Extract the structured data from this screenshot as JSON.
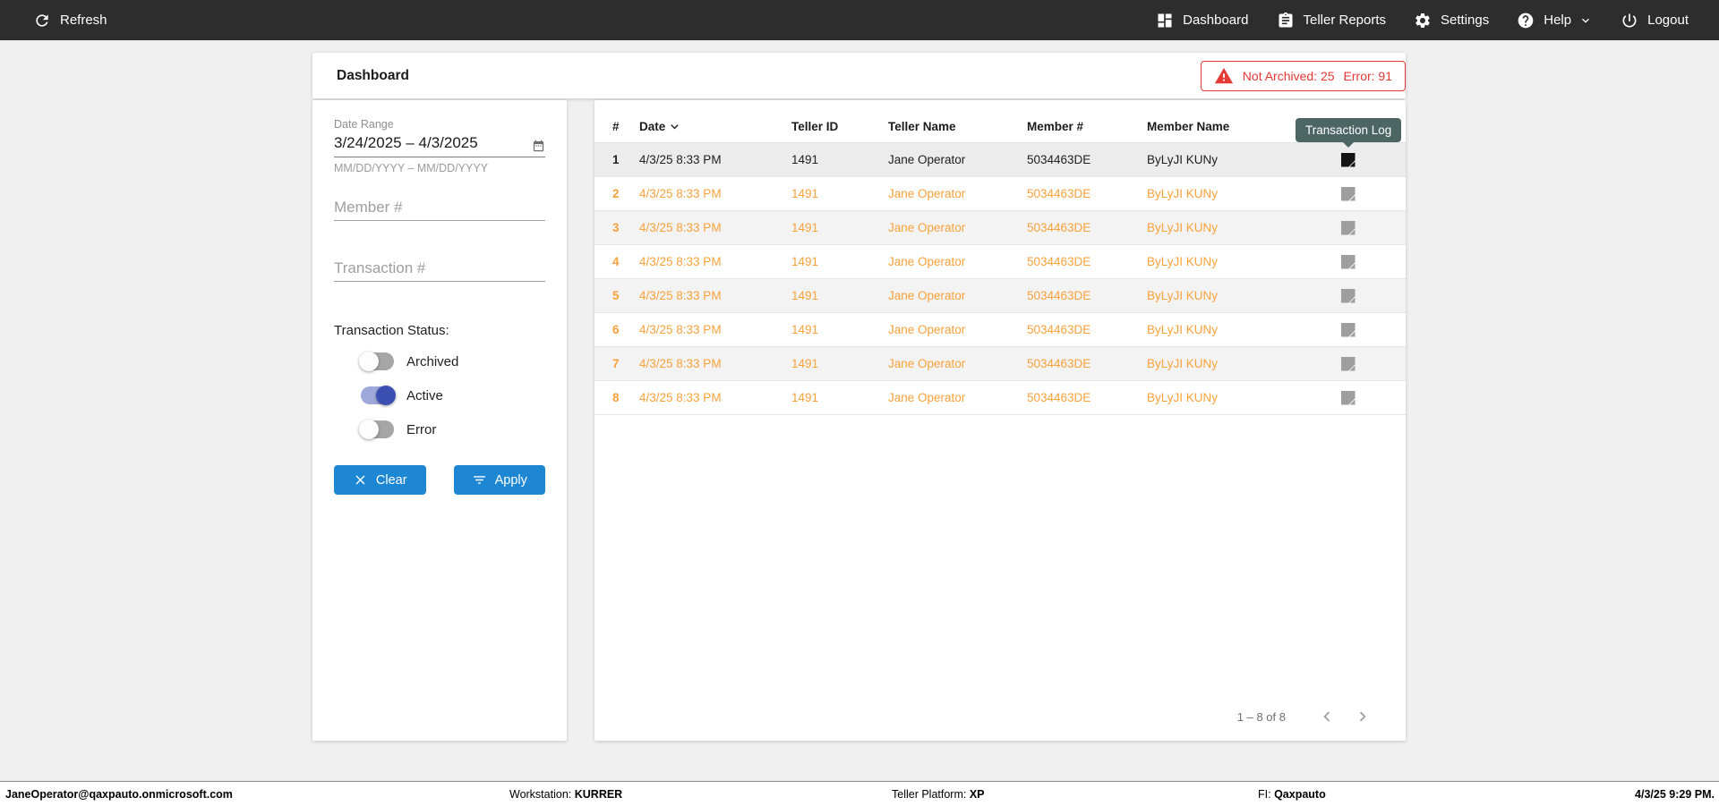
{
  "topbar": {
    "refresh_label": "Refresh",
    "nav": [
      {
        "label": "Dashboard"
      },
      {
        "label": "Teller Reports"
      },
      {
        "label": "Settings"
      },
      {
        "label": "Help"
      },
      {
        "label": "Logout"
      }
    ]
  },
  "page": {
    "title": "Dashboard"
  },
  "alert": {
    "not_archived_label": "Not Archived:",
    "not_archived_count": "25",
    "error_label": "Error:",
    "error_count": "91"
  },
  "filters": {
    "date_range_label": "Date Range",
    "date_range_value": "3/24/2025 – 4/3/2025",
    "date_range_hint": "MM/DD/YYYY – MM/DD/YYYY",
    "member_placeholder": "Member #",
    "transaction_placeholder": "Transaction #",
    "status_label": "Transaction Status:",
    "toggles": [
      {
        "label": "Archived",
        "on": false
      },
      {
        "label": "Active",
        "on": true
      },
      {
        "label": "Error",
        "on": false
      }
    ],
    "clear_label": "Clear",
    "apply_label": "Apply"
  },
  "table": {
    "columns": [
      "#",
      "Date",
      "Teller ID",
      "Teller Name",
      "Member #",
      "Member Name"
    ],
    "sorted_by": "Date",
    "sort_direction": "desc",
    "tooltip": "Transaction Log",
    "rows": [
      {
        "num": "1",
        "date": "4/3/25 8:33 PM",
        "teller_id": "1491",
        "teller_name": "Jane Operator",
        "member_num": "5034463DE",
        "member_name": "ByLyJI KUNy",
        "emphasis": "black",
        "hovered": true
      },
      {
        "num": "2",
        "date": "4/3/25 8:33 PM",
        "teller_id": "1491",
        "teller_name": "Jane Operator",
        "member_num": "5034463DE",
        "member_name": "ByLyJI KUNy",
        "emphasis": "orange",
        "hovered": false
      },
      {
        "num": "3",
        "date": "4/3/25 8:33 PM",
        "teller_id": "1491",
        "teller_name": "Jane Operator",
        "member_num": "5034463DE",
        "member_name": "ByLyJI KUNy",
        "emphasis": "orange",
        "hovered": false
      },
      {
        "num": "4",
        "date": "4/3/25 8:33 PM",
        "teller_id": "1491",
        "teller_name": "Jane Operator",
        "member_num": "5034463DE",
        "member_name": "ByLyJI KUNy",
        "emphasis": "orange",
        "hovered": false
      },
      {
        "num": "5",
        "date": "4/3/25 8:33 PM",
        "teller_id": "1491",
        "teller_name": "Jane Operator",
        "member_num": "5034463DE",
        "member_name": "ByLyJI KUNy",
        "emphasis": "orange",
        "hovered": false
      },
      {
        "num": "6",
        "date": "4/3/25 8:33 PM",
        "teller_id": "1491",
        "teller_name": "Jane Operator",
        "member_num": "5034463DE",
        "member_name": "ByLyJI KUNy",
        "emphasis": "orange",
        "hovered": false
      },
      {
        "num": "7",
        "date": "4/3/25 8:33 PM",
        "teller_id": "1491",
        "teller_name": "Jane Operator",
        "member_num": "5034463DE",
        "member_name": "ByLyJI KUNy",
        "emphasis": "orange",
        "hovered": false
      },
      {
        "num": "8",
        "date": "4/3/25 8:33 PM",
        "teller_id": "1491",
        "teller_name": "Jane Operator",
        "member_num": "5034463DE",
        "member_name": "ByLyJI KUNy",
        "emphasis": "orange",
        "hovered": false
      }
    ],
    "pagination_label": "1 – 8 of 8"
  },
  "footer": {
    "user_email": "JaneOperator@qaxpauto.onmicrosoft.com",
    "workstation_label": "Workstation:",
    "workstation_value": "KURRER",
    "platform_label": "Teller Platform:",
    "platform_value": "XP",
    "fi_label": "FI:",
    "fi_value": "Qaxpauto",
    "datetime": "4/3/25 9:29 PM."
  },
  "colors": {
    "topbar_bg": "#2d2d2d",
    "accent_blue": "#1e87d3",
    "alert_red": "#e53935",
    "row_orange": "#f9a13b",
    "toggle_on_thumb": "#3c50b4",
    "toggle_on_track": "#9fa8da",
    "tooltip_bg": "#4c6664",
    "page_bg": "#f0f0f0"
  }
}
